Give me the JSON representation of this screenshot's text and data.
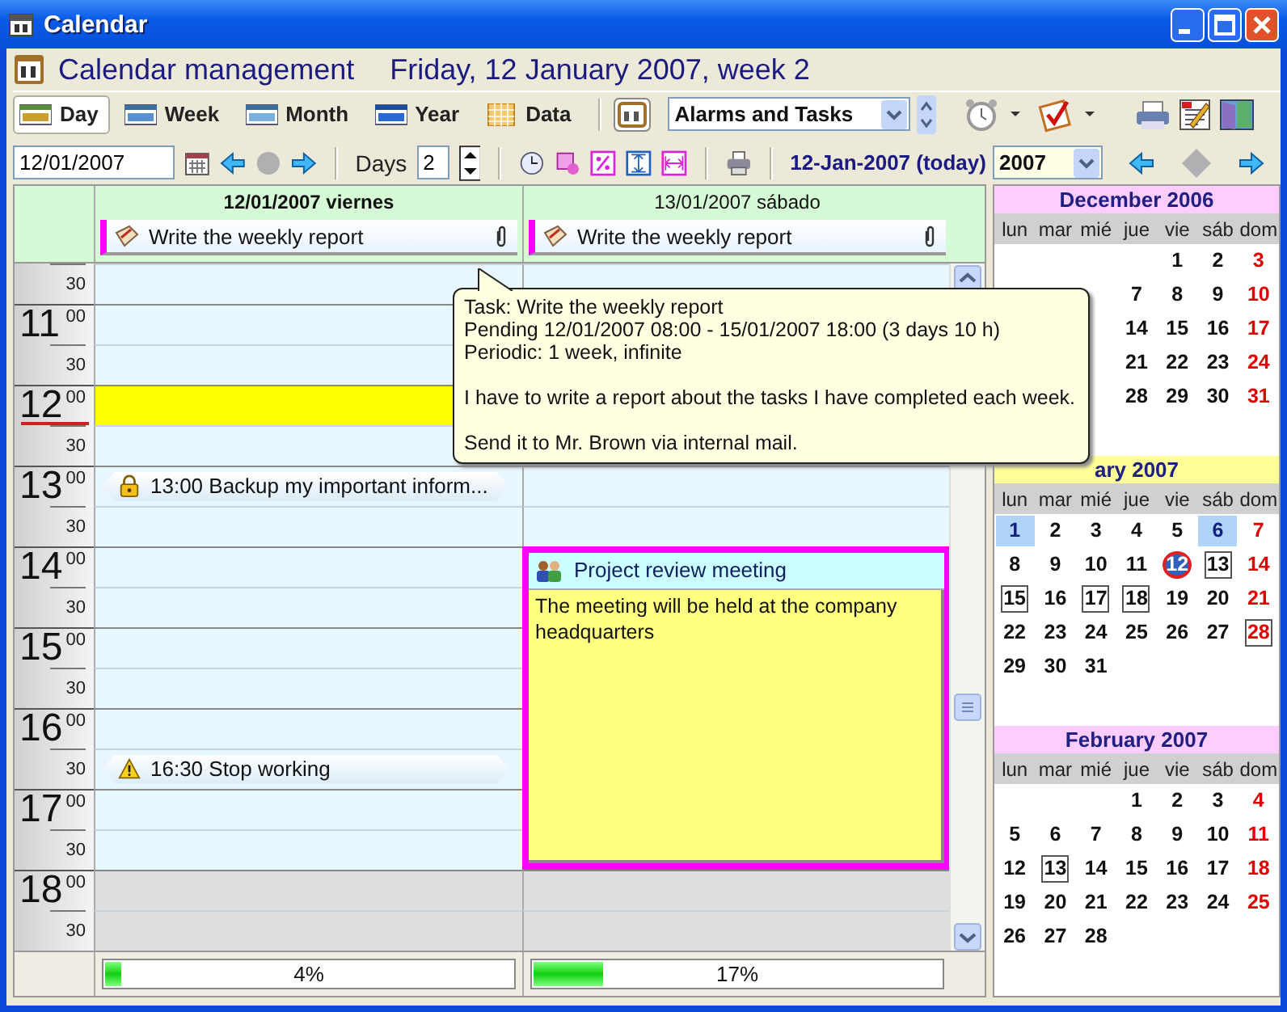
{
  "window": {
    "title": "Calendar"
  },
  "header": {
    "title": "Calendar management",
    "date": "Friday, 12 January 2007, week 2"
  },
  "view_tabs": [
    {
      "label": "Day",
      "selected": true
    },
    {
      "label": "Week",
      "selected": false
    },
    {
      "label": "Month",
      "selected": false
    },
    {
      "label": "Year",
      "selected": false
    },
    {
      "label": "Data",
      "selected": false
    }
  ],
  "filter_select": {
    "value": "Alarms and Tasks"
  },
  "nav_bar": {
    "date": "12/01/2007",
    "days_label": "Days",
    "days": "2",
    "today": "12-Jan-2007 (today)"
  },
  "year_select": {
    "value": "2007"
  },
  "day_view": {
    "columns": [
      {
        "title": "12/01/2007 viernes",
        "today": true,
        "task": {
          "text": "Write the weekly report",
          "attachment": true
        },
        "progress": {
          "level": 0.04,
          "text": "4%"
        }
      },
      {
        "title": "13/01/2007 sábado",
        "today": false,
        "task": {
          "text": "Write the weekly report",
          "attachment": true
        },
        "progress": {
          "level": 0.17,
          "text": "17%"
        }
      }
    ],
    "slots": [
      {
        "minutes": "30",
        "working": true,
        "current": false,
        "cells": [
          {
            "kind": "free"
          },
          {
            "kind": "free"
          }
        ]
      },
      {
        "hour": "11",
        "minutes": "00",
        "working": true,
        "current": false,
        "cells": [
          {
            "kind": "free"
          },
          {
            "kind": "covered"
          }
        ]
      },
      {
        "minutes": "30",
        "working": true,
        "current": false,
        "cells": [
          {
            "kind": "free"
          },
          {
            "kind": "covered"
          }
        ]
      },
      {
        "hour": "12",
        "minutes": "00",
        "working": true,
        "current": true,
        "cells": [
          {
            "kind": "free"
          },
          {
            "kind": "covered"
          }
        ]
      },
      {
        "minutes": "30",
        "working": true,
        "current": false,
        "cells": [
          {
            "kind": "free"
          },
          {
            "kind": "free"
          }
        ]
      },
      {
        "hour": "13",
        "minutes": "00",
        "working": true,
        "current": false,
        "cells": [
          {
            "kind": "reminder",
            "private": true,
            "text": "13:00 Backup my important inform..."
          },
          {
            "kind": "free"
          }
        ]
      },
      {
        "minutes": "30",
        "working": true,
        "current": false,
        "cells": [
          {
            "kind": "free"
          },
          {
            "kind": "free"
          }
        ]
      },
      {
        "hour": "14",
        "minutes": "00",
        "working": true,
        "current": false,
        "cells": [
          {
            "kind": "free"
          },
          {
            "kind": "meeting",
            "title": "Project review meeting",
            "note": "The meeting will be held at the company headquarters"
          }
        ]
      },
      {
        "minutes": "30",
        "working": true,
        "current": false,
        "cells": [
          {
            "kind": "free"
          },
          {
            "kind": "continued"
          }
        ]
      },
      {
        "hour": "15",
        "minutes": "00",
        "working": true,
        "current": false,
        "cells": [
          {
            "kind": "free"
          },
          {
            "kind": "continued"
          }
        ]
      },
      {
        "minutes": "30",
        "working": true,
        "current": false,
        "cells": [
          {
            "kind": "free"
          },
          {
            "kind": "continued"
          }
        ]
      },
      {
        "hour": "16",
        "minutes": "00",
        "working": true,
        "current": false,
        "cells": [
          {
            "kind": "free"
          },
          {
            "kind": "continued"
          }
        ]
      },
      {
        "minutes": "30",
        "working": true,
        "current": false,
        "cells": [
          {
            "kind": "reminder",
            "private": false,
            "text": "16:30 Stop working"
          },
          {
            "kind": "continued"
          }
        ]
      },
      {
        "hour": "17",
        "minutes": "00",
        "working": true,
        "current": false,
        "cells": [
          {
            "kind": "free"
          },
          {
            "kind": "continued"
          }
        ]
      },
      {
        "minutes": "30",
        "working": true,
        "current": false,
        "cells": [
          {
            "kind": "free"
          },
          {
            "kind": "continued"
          }
        ]
      },
      {
        "hour": "18",
        "minutes": "00",
        "working": false,
        "current": false,
        "cells": [
          {
            "kind": "free"
          },
          {
            "kind": "free"
          }
        ]
      },
      {
        "minutes": "30",
        "working": false,
        "current": false,
        "cells": [
          {
            "kind": "free"
          },
          {
            "kind": "free"
          }
        ]
      }
    ]
  },
  "tooltip": {
    "paragraphs": [
      [
        "Task: Write the weekly report",
        "Pending 12/01/2007 08:00 - 15/01/2007 18:00 (3 days 10 h)",
        "Periodic: 1 week, infinite"
      ],
      [
        "I have to write a report about the tasks I have completed each week."
      ],
      [
        "Send it to Mr. Brown via internal mail."
      ]
    ]
  },
  "mini_calendars": [
    {
      "title": "December 2006",
      "current": false,
      "weekdays": [
        "lun",
        "mar",
        "mié",
        "jue",
        "vie",
        "sáb",
        "dom"
      ],
      "weeks": [
        [
          {
            "kind": "blank"
          },
          {
            "kind": "blank"
          },
          {
            "kind": "blank"
          },
          {
            "kind": "blank"
          },
          {
            "d": "1",
            "kind": "day"
          },
          {
            "d": "2",
            "kind": "day"
          },
          {
            "d": "3",
            "kind": "sunday"
          }
        ],
        [
          {
            "kind": "blank"
          },
          {
            "kind": "blank"
          },
          {
            "kind": "blank"
          },
          {
            "d": "7",
            "kind": "day"
          },
          {
            "d": "8",
            "kind": "day"
          },
          {
            "d": "9",
            "kind": "day"
          },
          {
            "d": "10",
            "kind": "sunday"
          }
        ],
        [
          {
            "kind": "blank"
          },
          {
            "kind": "blank"
          },
          {
            "kind": "blank"
          },
          {
            "d": "14",
            "kind": "day"
          },
          {
            "d": "15",
            "kind": "day"
          },
          {
            "d": "16",
            "kind": "day"
          },
          {
            "d": "17",
            "kind": "sunday"
          }
        ],
        [
          {
            "kind": "blank"
          },
          {
            "kind": "blank"
          },
          {
            "kind": "blank"
          },
          {
            "d": "21",
            "kind": "day"
          },
          {
            "d": "22",
            "kind": "day"
          },
          {
            "d": "23",
            "kind": "day"
          },
          {
            "d": "24",
            "kind": "sunday"
          }
        ],
        [
          {
            "kind": "blank"
          },
          {
            "kind": "blank"
          },
          {
            "kind": "blank"
          },
          {
            "d": "28",
            "kind": "day"
          },
          {
            "d": "29",
            "kind": "day"
          },
          {
            "d": "30",
            "kind": "day"
          },
          {
            "d": "31",
            "kind": "sunday"
          }
        ]
      ]
    },
    {
      "title": "ary 2007",
      "current": true,
      "weekdays": [
        "lun",
        "mar",
        "mié",
        "jue",
        "vie",
        "sáb",
        "dom"
      ],
      "weeks": [
        [
          {
            "d": "1",
            "kind": "holiday"
          },
          {
            "d": "2",
            "kind": "day"
          },
          {
            "d": "3",
            "kind": "day"
          },
          {
            "d": "4",
            "kind": "day"
          },
          {
            "d": "5",
            "kind": "day"
          },
          {
            "d": "6",
            "kind": "holiday"
          },
          {
            "d": "7",
            "kind": "sunday"
          }
        ],
        [
          {
            "d": "8",
            "kind": "day"
          },
          {
            "d": "9",
            "kind": "day"
          },
          {
            "d": "10",
            "kind": "day"
          },
          {
            "d": "11",
            "kind": "day"
          },
          {
            "d": "12",
            "kind": "today"
          },
          {
            "d": "13",
            "kind": "event"
          },
          {
            "d": "14",
            "kind": "sunday"
          }
        ],
        [
          {
            "d": "15",
            "kind": "event"
          },
          {
            "d": "16",
            "kind": "day"
          },
          {
            "d": "17",
            "kind": "event"
          },
          {
            "d": "18",
            "kind": "event"
          },
          {
            "d": "19",
            "kind": "day"
          },
          {
            "d": "20",
            "kind": "day"
          },
          {
            "d": "21",
            "kind": "sunday"
          }
        ],
        [
          {
            "d": "22",
            "kind": "day"
          },
          {
            "d": "23",
            "kind": "day"
          },
          {
            "d": "24",
            "kind": "day"
          },
          {
            "d": "25",
            "kind": "day"
          },
          {
            "d": "26",
            "kind": "day"
          },
          {
            "d": "27",
            "kind": "day"
          },
          {
            "d": "28",
            "kind": "sunday_event"
          }
        ],
        [
          {
            "d": "29",
            "kind": "day"
          },
          {
            "d": "30",
            "kind": "day"
          },
          {
            "d": "31",
            "kind": "day"
          }
        ]
      ]
    },
    {
      "title": "February 2007",
      "current": false,
      "weekdays": [
        "lun",
        "mar",
        "mié",
        "jue",
        "vie",
        "sáb",
        "dom"
      ],
      "weeks": [
        [
          {
            "kind": "blank"
          },
          {
            "kind": "blank"
          },
          {
            "kind": "blank"
          },
          {
            "d": "1",
            "kind": "day"
          },
          {
            "d": "2",
            "kind": "day"
          },
          {
            "d": "3",
            "kind": "day"
          },
          {
            "d": "4",
            "kind": "sunday"
          }
        ],
        [
          {
            "d": "5",
            "kind": "day"
          },
          {
            "d": "6",
            "kind": "day"
          },
          {
            "d": "7",
            "kind": "day"
          },
          {
            "d": "8",
            "kind": "day"
          },
          {
            "d": "9",
            "kind": "day"
          },
          {
            "d": "10",
            "kind": "day"
          },
          {
            "d": "11",
            "kind": "sunday"
          }
        ],
        [
          {
            "d": "12",
            "kind": "day"
          },
          {
            "d": "13",
            "kind": "event"
          },
          {
            "d": "14",
            "kind": "day"
          },
          {
            "d": "15",
            "kind": "day"
          },
          {
            "d": "16",
            "kind": "day"
          },
          {
            "d": "17",
            "kind": "day"
          },
          {
            "d": "18",
            "kind": "sunday"
          }
        ],
        [
          {
            "d": "19",
            "kind": "day"
          },
          {
            "d": "20",
            "kind": "day"
          },
          {
            "d": "21",
            "kind": "day"
          },
          {
            "d": "22",
            "kind": "day"
          },
          {
            "d": "23",
            "kind": "day"
          },
          {
            "d": "24",
            "kind": "day"
          },
          {
            "d": "25",
            "kind": "sunday"
          }
        ],
        [
          {
            "d": "26",
            "kind": "day"
          },
          {
            "d": "27",
            "kind": "day"
          },
          {
            "d": "28",
            "kind": "day"
          }
        ]
      ]
    }
  ]
}
